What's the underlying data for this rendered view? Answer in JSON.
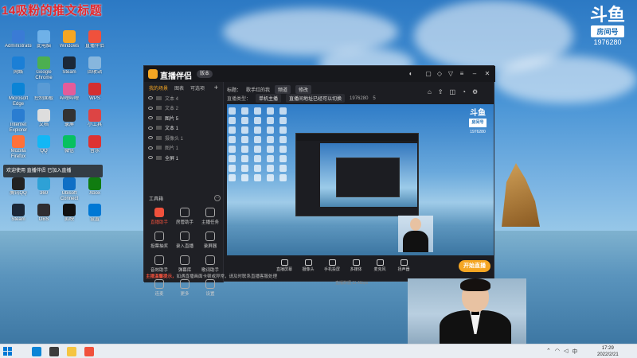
{
  "overlay": {
    "caption": "14吸粉的推文标题"
  },
  "douyu": {
    "mark": "斗鱼",
    "tag": "房间号",
    "room": "1976280"
  },
  "desktop_icons": [
    {
      "label": "Administrator",
      "color": "#3a7bd5"
    },
    {
      "label": "此电脑",
      "color": "#6fb1e8"
    },
    {
      "label": "Windows",
      "color": "#f5a623"
    },
    {
      "label": "直播伴侣",
      "color": "#f0513c"
    },
    {
      "label": "网络",
      "color": "#1b7fd6"
    },
    {
      "label": "Google Chrome",
      "color": "#4caf50"
    },
    {
      "label": "Steam",
      "color": "#1b2838"
    },
    {
      "label": "回收站",
      "color": "#87b6dd"
    },
    {
      "label": "Microsoft Edge",
      "color": "#0b84d6"
    },
    {
      "label": "控制面板",
      "color": "#5a9bd5"
    },
    {
      "label": "哔哩哔哩",
      "color": "#e35c9a"
    },
    {
      "label": "WPS",
      "color": "#d32f2f"
    },
    {
      "label": "Internet Explorer",
      "color": "#2a7dd1"
    },
    {
      "label": "文档",
      "color": "#ddd"
    },
    {
      "label": "录屏",
      "color": "#333"
    },
    {
      "label": "小工具",
      "color": "#d44"
    },
    {
      "label": "Mozilla Firefox",
      "color": "#ff7139"
    },
    {
      "label": "QQ",
      "color": "#12b7f5"
    },
    {
      "label": "微信",
      "color": "#07c160"
    },
    {
      "label": "音乐",
      "color": "#d33"
    },
    {
      "label": "腾讯QQ",
      "color": "#222"
    },
    {
      "label": "360",
      "color": "#2ea1d6"
    },
    {
      "label": "Ubisoft Connect",
      "color": "#0f6fc5"
    },
    {
      "label": "Xbox",
      "color": "#107c10"
    },
    {
      "label": "Steam",
      "color": "#1b2838"
    },
    {
      "label": "OBS",
      "color": "#302e31"
    },
    {
      "label": "剪映",
      "color": "#111"
    },
    {
      "label": "设置",
      "color": "#0078d4"
    }
  ],
  "toast": {
    "text": "欢迎使用 直播伴侣 已加入直播"
  },
  "app": {
    "title": "直播伴侣",
    "version": "版本",
    "scene_tabs": [
      "我的场景",
      "图表",
      "可选项"
    ],
    "layers": [
      {
        "label": "文本 4",
        "on": false
      },
      {
        "label": "文本 2",
        "on": false
      },
      {
        "label": "图片 5",
        "on": true
      },
      {
        "label": "文本 1",
        "on": true
      },
      {
        "label": "摄像头 1",
        "on": false
      },
      {
        "label": "图片 1",
        "on": false
      },
      {
        "label": "全屏 1",
        "on": true
      }
    ],
    "tools_title": "工具箱",
    "tools": [
      {
        "label": "直播助手",
        "hot": true
      },
      {
        "label": "房管助手",
        "hot": false
      },
      {
        "label": "主播任务",
        "hot": false
      },
      {
        "label": "投票抽奖",
        "hot": false
      },
      {
        "label": "录入直播",
        "hot": false
      },
      {
        "label": "录屏器",
        "hot": false
      },
      {
        "label": "音效助手",
        "hot": false
      },
      {
        "label": "弹幕库",
        "hot": false
      },
      {
        "label": "歌词助手",
        "hot": false
      },
      {
        "label": "连麦",
        "hot": false
      },
      {
        "label": "更多",
        "hot": false
      },
      {
        "label": "设置",
        "hot": false
      }
    ],
    "info": {
      "title_label": "标题：",
      "title_value": "歌手红的我",
      "category": "频道",
      "edit": "修改",
      "room_label": "直播类型：",
      "room_type": "单机主播",
      "room_hint": "直播间地址已经可以切换",
      "room_id": "1976280",
      "count": "5"
    },
    "bottom_tools": [
      "直播屏幕",
      "摄像头",
      "手机投屏",
      "多媒体",
      "麦克风",
      "扬声器"
    ],
    "go_live": "开始直播",
    "notice_tag": "主播温馨提示，",
    "notice_text": "如遇直播画面卡顿或异常，请及时联系直播客服处理",
    "live_tiny": "直播",
    "preview_status": "直播数据 11.4kbps",
    "preview_logo": {
      "mark": "斗鱼",
      "tag": "房间号",
      "room": "1976280"
    }
  },
  "taskbar": {
    "apps": [
      {
        "name": "edge",
        "color": "#0b84d6"
      },
      {
        "name": "chrome",
        "color": "#3c3c3c"
      },
      {
        "name": "explorer",
        "color": "#f5c542"
      },
      {
        "name": "live-helper",
        "color": "#f0513c"
      }
    ],
    "time": "17:29",
    "date": "2022/2/21"
  }
}
